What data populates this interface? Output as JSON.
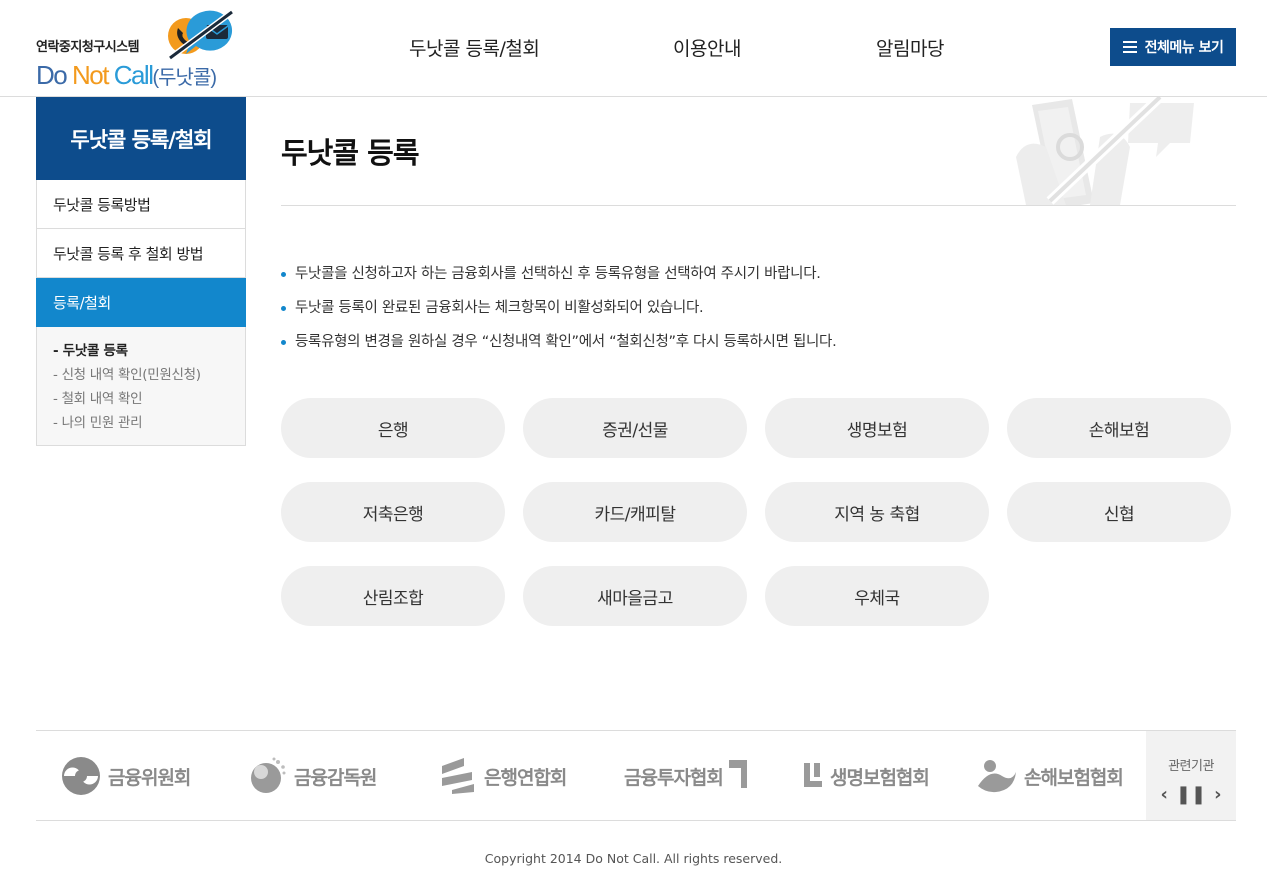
{
  "header": {
    "logo_sub": "연락중지청구시스템",
    "logo_do": "Do",
    "logo_not": "Not",
    "logo_call": "Call",
    "logo_kor": "(두낫콜)",
    "nav": [
      "두낫콜 등록/철회",
      "이용안내",
      "알림마당"
    ],
    "allmenu_label": "전체메뉴 보기"
  },
  "sidebar": {
    "title": "두낫콜 등록/철회",
    "items": [
      "두낫콜 등록방법",
      "두낫콜 등록 후 철회 방법",
      "등록/철회"
    ],
    "sub_items": [
      "- 두낫콜 등록",
      "- 신청 내역 확인(민원신청)",
      "- 철회 내역 확인",
      "- 나의 민원 관리"
    ]
  },
  "main": {
    "title": "두낫콜 등록",
    "notices": [
      "두낫콜을 신청하고자 하는 금융회사를 선택하신 후 등록유형을 선택하여 주시기 바랍니다.",
      "두낫콜 등록이 완료된 금융회사는 체크항목이 비활성화되어 있습니다.",
      "등록유형의 변경을 원하실 경우 “신청내역 확인”에서 “철회신청”후 다시 등록하시면 됩니다."
    ],
    "categories": [
      "은행",
      "증권/선물",
      "생명보험",
      "손해보험",
      "저축은행",
      "카드/캐피탈",
      "지역 농 축협",
      "신협",
      "산림조합",
      "새마을금고",
      "우체국"
    ]
  },
  "footer": {
    "orgs": [
      "금융위원회",
      "금융감독원",
      "은행연합회",
      "금융투자협회",
      "생명보험협회",
      "손해보험협회"
    ],
    "related_label": "관련기관",
    "copyright": "Copyright 2014 Do Not Call. All rights reserved."
  },
  "colors": {
    "primary": "#0d4c8c",
    "accent": "#1287cc",
    "button_bg": "#efefef"
  }
}
